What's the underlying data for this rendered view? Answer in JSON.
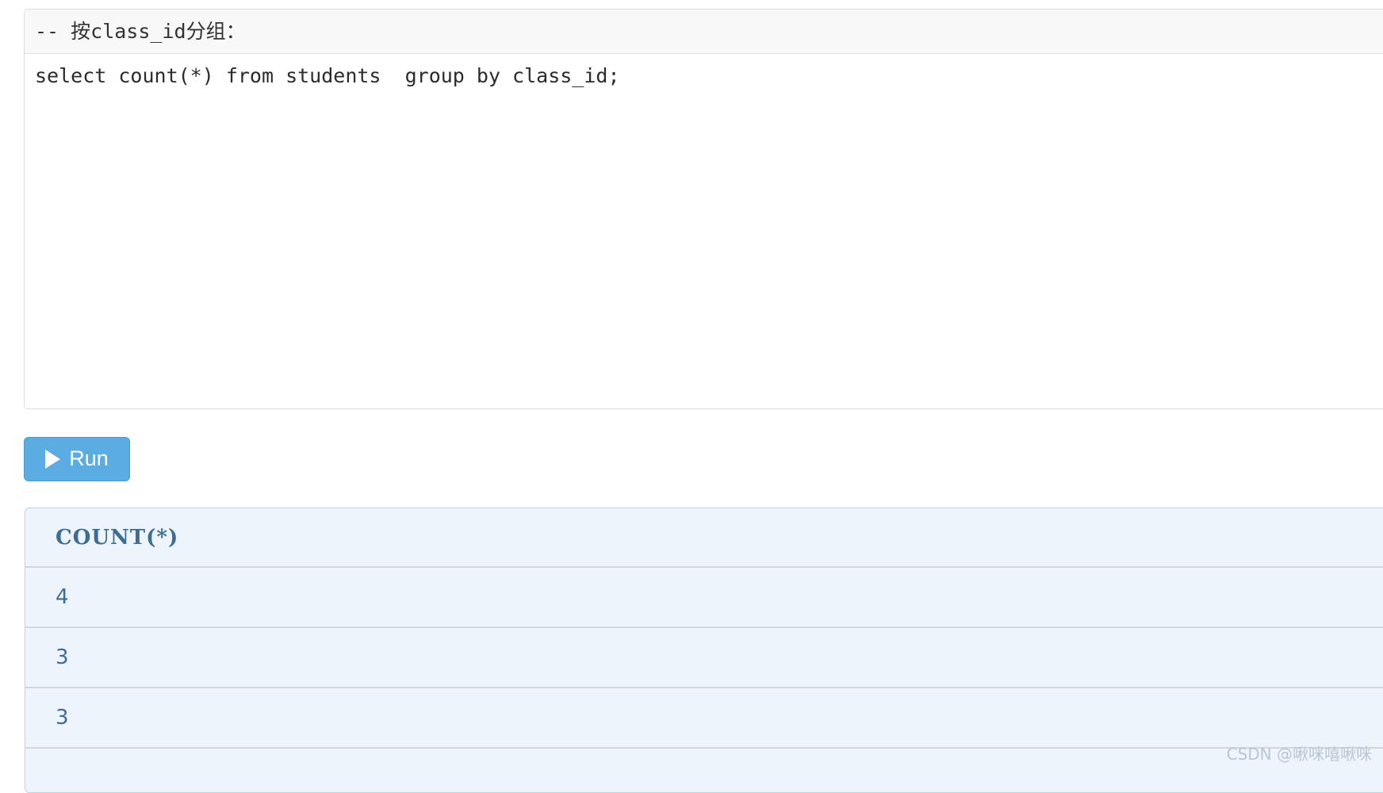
{
  "editor": {
    "name": "sql-editor",
    "lines": [
      {
        "text": "-- 按class_id分组：",
        "type": "comment",
        "active": true
      },
      {
        "text": "select count(*) from students  group by class_id;",
        "type": "sql",
        "active": false
      }
    ]
  },
  "toolbar": {
    "run_label": "Run",
    "run_icon": "play-icon",
    "accent_color": "#5aace2"
  },
  "results": {
    "columns": [
      "COUNT(*)"
    ],
    "rows": [
      [
        "4"
      ],
      [
        "3"
      ],
      [
        "3"
      ]
    ],
    "background_color": "#eef4fc",
    "border_color": "#b9d3e7",
    "text_color": "#3c6e95"
  },
  "watermark": {
    "text": "CSDN @啾咪嘻啾咪"
  }
}
